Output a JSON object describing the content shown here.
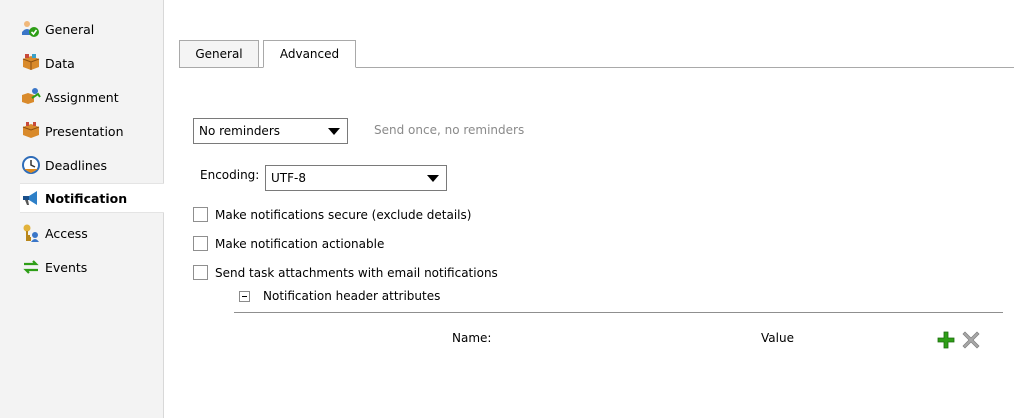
{
  "sidebar": {
    "items": [
      {
        "label": "General",
        "icon": "people-check-icon"
      },
      {
        "label": "Data",
        "icon": "data-box-icon"
      },
      {
        "label": "Assignment",
        "icon": "assignment-icon"
      },
      {
        "label": "Presentation",
        "icon": "presentation-box-icon"
      },
      {
        "label": "Deadlines",
        "icon": "clock-icon"
      },
      {
        "label": "Notification",
        "icon": "megaphone-icon",
        "active": true
      },
      {
        "label": "Access",
        "icon": "key-user-icon"
      },
      {
        "label": "Events",
        "icon": "events-arrows-icon"
      }
    ]
  },
  "tabs": [
    {
      "label": "General"
    },
    {
      "label": "Advanced",
      "active": true
    }
  ],
  "reminders": {
    "selected": "No reminders",
    "hint": "Send once, no reminders"
  },
  "encoding": {
    "label": "Encoding:",
    "selected": "UTF-8"
  },
  "checkboxes": [
    {
      "label": "Make notifications secure (exclude details)",
      "checked": false
    },
    {
      "label": "Make notification actionable",
      "checked": false
    },
    {
      "label": "Send task attachments with email notifications",
      "checked": false
    }
  ],
  "header_attributes": {
    "section_label": "Notification header attributes",
    "columns": {
      "name": "Name:",
      "value": "Value"
    }
  },
  "colors": {
    "add_green": "#2e9e17",
    "delete_gray": "#9a9a9a",
    "active_item_bg": "#ffffff"
  }
}
